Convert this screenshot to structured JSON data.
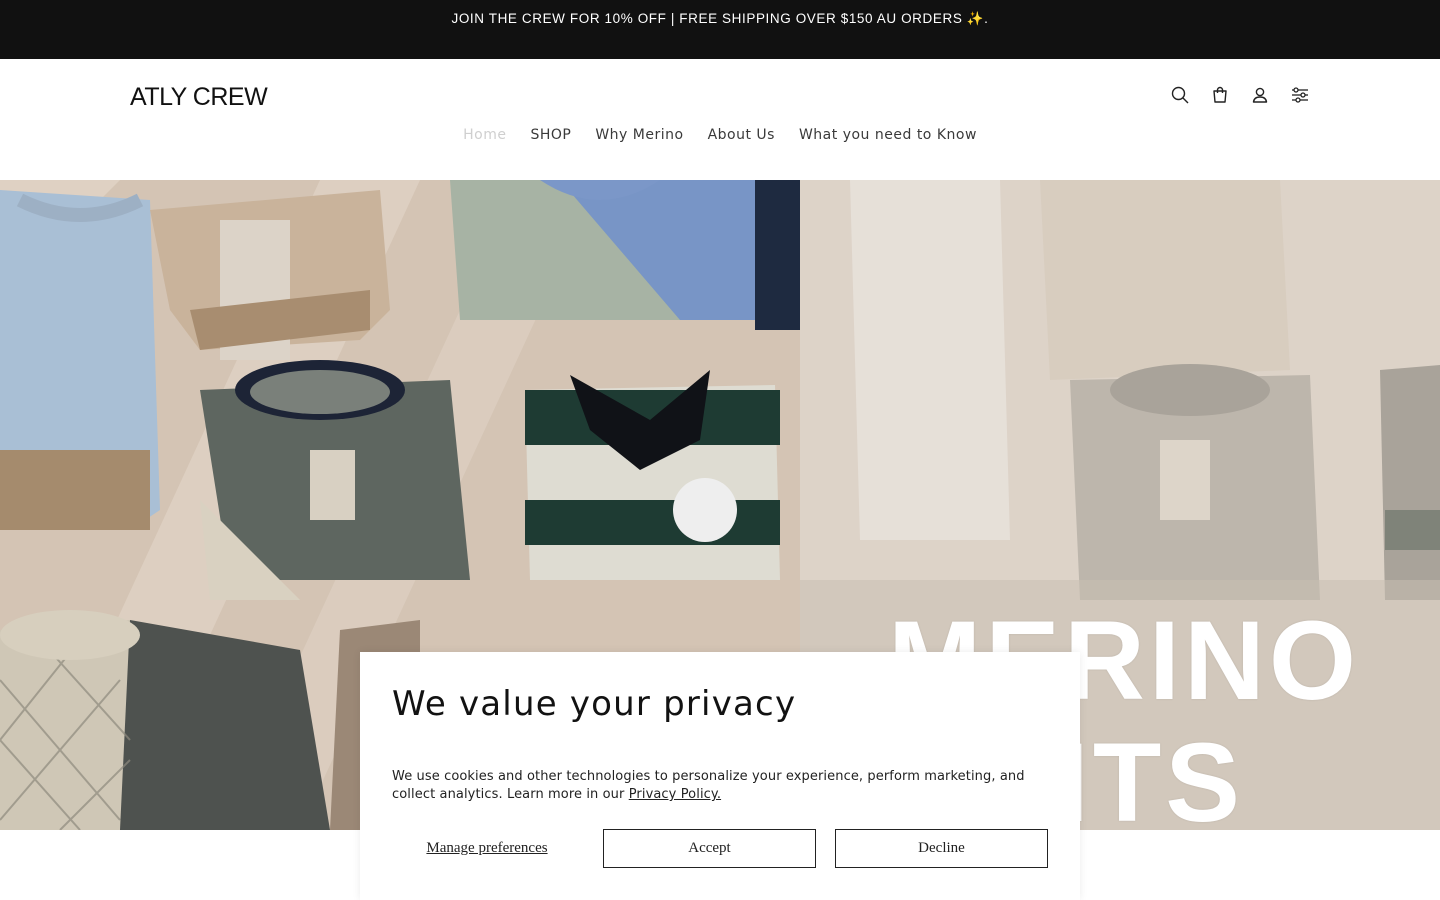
{
  "announcement": {
    "text": "JOIN THE CREW FOR 10% OFF | FREE SHIPPING OVER $150 AU ORDERS ✨."
  },
  "header": {
    "logo": "ATLY CREW",
    "nav": [
      {
        "label": "Home",
        "active": true
      },
      {
        "label": "SHOP"
      },
      {
        "label": "Why Merino"
      },
      {
        "label": "About Us"
      },
      {
        "label": "What you need to Know"
      }
    ],
    "icons": [
      "search-icon",
      "cart-icon",
      "account-icon",
      "settings-icon"
    ]
  },
  "hero": {
    "overlay_text_line1": "MERINO",
    "overlay_text_line2": "KNITS"
  },
  "cookie_banner": {
    "title": "We value your privacy",
    "body": "We use cookies and other technologies to personalize your experience, perform marketing, and collect analytics. Learn more in our ",
    "privacy_link": "Privacy Policy.",
    "manage_label": "Manage preferences",
    "accept_label": "Accept",
    "decline_label": "Decline"
  }
}
